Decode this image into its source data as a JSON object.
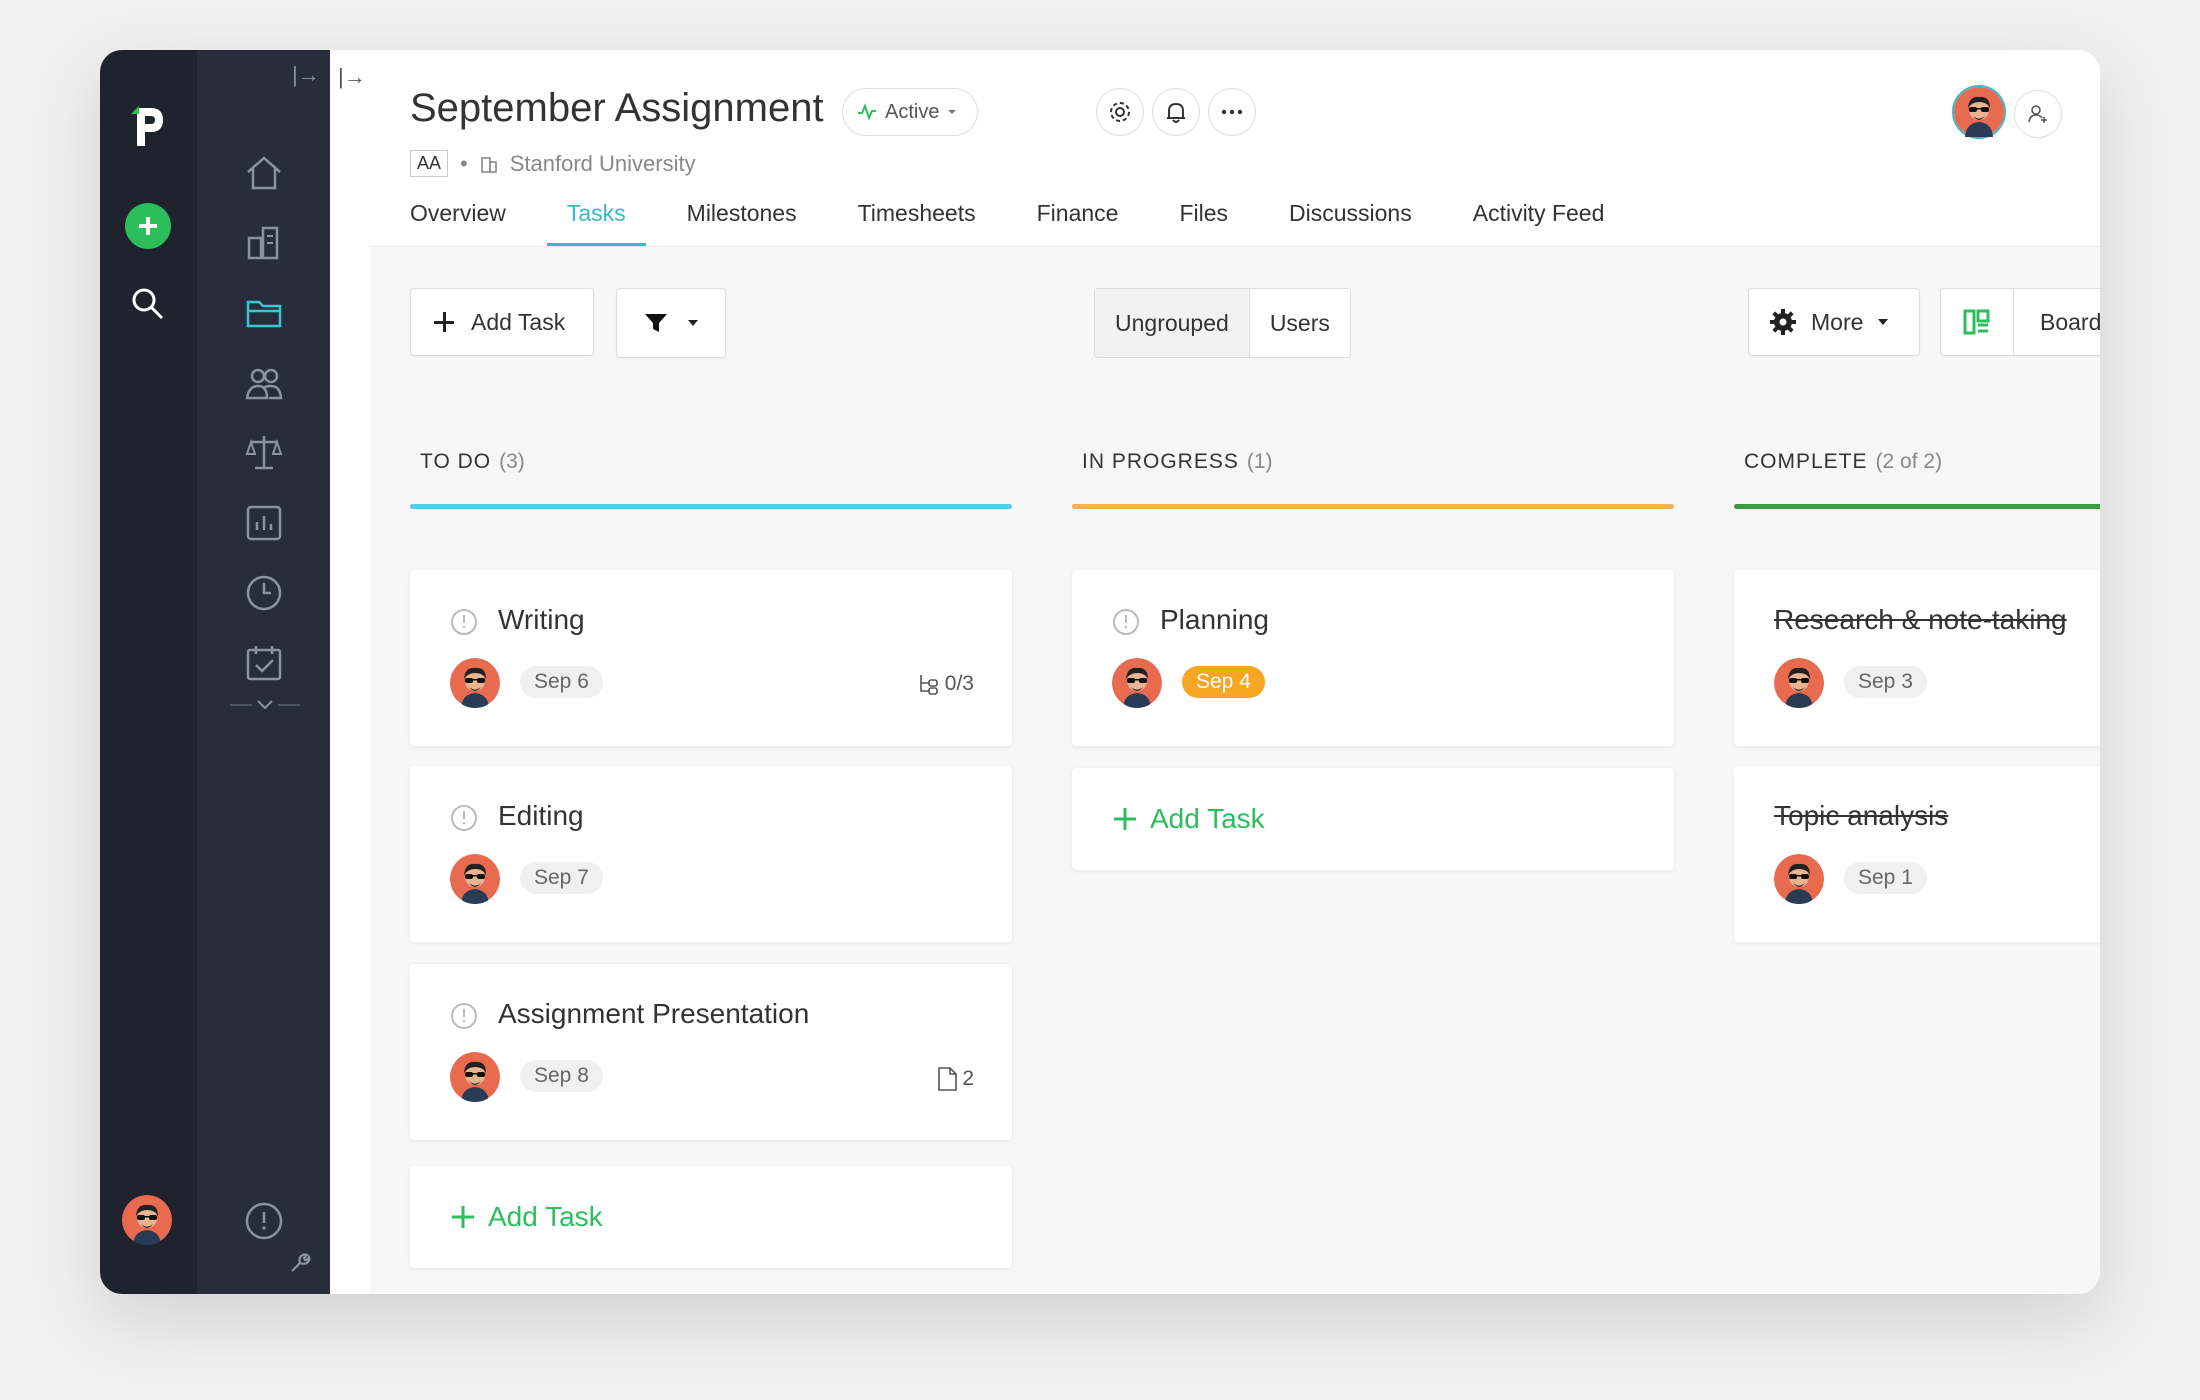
{
  "project": {
    "title": "September Assignment",
    "status": "Active",
    "initials": "AA",
    "client": "Stanford University"
  },
  "tabs": [
    "Overview",
    "Tasks",
    "Milestones",
    "Timesheets",
    "Finance",
    "Files",
    "Discussions",
    "Activity Feed"
  ],
  "active_tab": "Tasks",
  "toolbar": {
    "add_task": "Add Task",
    "group_ungrouped": "Ungrouped",
    "group_users": "Users",
    "more": "More",
    "view": "Board"
  },
  "columns": [
    {
      "title": "TO DO",
      "count": "(3)",
      "color": "#5bc8ec",
      "tasks": [
        {
          "name": "Writing",
          "date": "Sep 6",
          "meta": "0/3",
          "meta_icon": "subtasks-icon"
        },
        {
          "name": "Editing",
          "date": "Sep 7"
        },
        {
          "name": "Assignment Presentation",
          "date": "Sep 8",
          "meta": "2",
          "meta_icon": "file-icon"
        }
      ],
      "add_label": "Add Task"
    },
    {
      "title": "IN PROGRESS",
      "count": "(1)",
      "color": "#f8b350",
      "tasks": [
        {
          "name": "Planning",
          "date": "Sep 4",
          "due": true
        }
      ],
      "add_label": "Add Task"
    },
    {
      "title": "COMPLETE",
      "count": "(2 of 2)",
      "color": "#3a9c3f",
      "tasks": [
        {
          "name": "Research & note-taking",
          "date": "Sep 3",
          "done": true
        },
        {
          "name": "Topic analysis",
          "date": "Sep 1",
          "done": true
        }
      ]
    }
  ],
  "colors": {
    "accent": "#3bb7c7",
    "green": "#2dbe5c",
    "sidebar": "#1e232e",
    "due": "#f6a623"
  }
}
